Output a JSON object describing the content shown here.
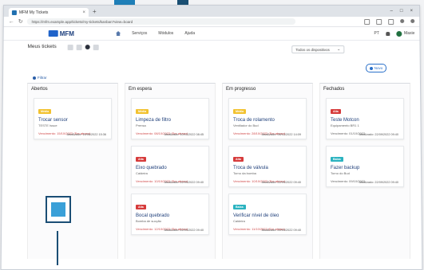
{
  "browser": {
    "tab_title": "MFM My Tickets",
    "url": "https://mfm.example.app/tickets/my-tickets/kanban?view=board"
  },
  "app": {
    "logo_text": "MFM",
    "nav": [
      "Serviços",
      "Módulos",
      "Ajuda"
    ],
    "lang": "PT",
    "user": "Maxie"
  },
  "page": {
    "title": "Meus tickets",
    "filter_label": "Todos os dispositivos",
    "new_button": "Novo",
    "filter_link": "Filtrar"
  },
  "columns": [
    {
      "title": "Abertos",
      "cards": [
        {
          "badge": "Média",
          "badge_color": "#f2c230",
          "title": "Trocar sensor",
          "sub": "TESTE Issue",
          "due": "Vencimento: 15/10/2022 (Em atraso)",
          "upd": "Atualizado: 14/06/2022 15:36"
        }
      ]
    },
    {
      "title": "Em espera",
      "cards": [
        {
          "badge": "Média",
          "badge_color": "#f2c230",
          "title": "Limpeza de filtro",
          "sub": "Prensa",
          "due": "Vencimento: 08/10/2022 (Em atraso)",
          "upd": "Atualizado: 10/10/2022 08:45"
        },
        {
          "badge": "Alta",
          "badge_color": "#d63b3b",
          "title": "Eixo quebrado",
          "sub": "Caldeira",
          "due": "Vencimento: 10/10/2022 (Em atraso)",
          "upd": "Atualizado: 22/09/2022 09:40"
        },
        {
          "badge": "Alta",
          "badge_color": "#d63b3b",
          "title": "Bocal quebrado",
          "sub": "Bomba de sucção",
          "due": "Vencimento: 12/10/2022 (Em atraso)",
          "upd": "Atualizado: 22/09/2022 09:40"
        }
      ]
    },
    {
      "title": "Em progresso",
      "cards": [
        {
          "badge": "Média",
          "badge_color": "#f2c230",
          "title": "Troca de rolamento",
          "sub": "Ventilador do Bud",
          "due": "Vencimento: 28/10/2022 (Em atraso)",
          "upd": "Atualizado: 06/12/2022 14:09"
        },
        {
          "badge": "Alta",
          "badge_color": "#d63b3b",
          "title": "Troca de válvula",
          "sub": "Torno da bomba",
          "due": "Vencimento: 10/10/2022 (Em atraso)",
          "upd": "Atualizado: 22/09/2022 09:40"
        },
        {
          "badge": "Baixa",
          "badge_color": "#2bb3c0",
          "title": "Verificar nível de óleo",
          "sub": "Caldeira",
          "due": "Vencimento: 11/10/2022 (Em atraso)",
          "upd": "Atualizado: 22/09/2022 09:40"
        }
      ]
    },
    {
      "title": "Fechados",
      "cards": [
        {
          "badge": "Alta",
          "badge_color": "#d63b3b",
          "title": "Teste Motcon",
          "sub": "Equipamento BR1 1",
          "due": "Vencimento: 01/10/2022",
          "upd": "Atualizado: 22/09/2022 09:40"
        },
        {
          "badge": "Baixa",
          "badge_color": "#2bb3c0",
          "title": "Fazer backup",
          "sub": "Torno do Bud",
          "due": "Vencimento: 09/10/2022",
          "upd": "Atualizado: 22/09/2022 09:40"
        }
      ]
    }
  ]
}
